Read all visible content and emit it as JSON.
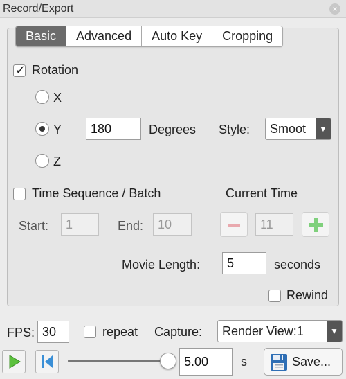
{
  "window": {
    "title": "Record/Export",
    "close_glyph": "×"
  },
  "tabs": [
    {
      "label": "Basic",
      "active": true
    },
    {
      "label": "Advanced",
      "active": false
    },
    {
      "label": "Auto Key",
      "active": false
    },
    {
      "label": "Cropping",
      "active": false
    }
  ],
  "rotation": {
    "enabled_label": "Rotation",
    "checked": true,
    "axes": [
      {
        "label": "X",
        "selected": false
      },
      {
        "label": "Y",
        "selected": true
      },
      {
        "label": "Z",
        "selected": false
      }
    ],
    "degrees_value": "180",
    "degrees_label": "Degrees",
    "style_label": "Style:",
    "style_value": "Smoot"
  },
  "time_sequence": {
    "label": "Time Sequence / Batch",
    "checked": false,
    "start_label": "Start:",
    "start_value": "1",
    "end_label": "End:",
    "end_value": "10",
    "current_time_label": "Current Time",
    "current_time_value": "11"
  },
  "movie": {
    "length_label": "Movie Length:",
    "length_value": "5",
    "unit_label": "seconds",
    "rewind_label": "Rewind",
    "rewind_checked": false
  },
  "bottom": {
    "fps_label": "FPS:",
    "fps_value": "30",
    "repeat_label": "repeat",
    "repeat_checked": false,
    "capture_label": "Capture:",
    "capture_value": "Render View:1",
    "time_value": "5.00",
    "time_unit": "s",
    "save_label": "Save...",
    "slider_position": 1.0
  },
  "colors": {
    "tab_active_bg": "#6b6b6b",
    "play_green": "#5cc13e",
    "rewind_blue": "#3a8fd6",
    "minus_red": "#e9a9ae",
    "plus_green": "#7fd07c"
  }
}
